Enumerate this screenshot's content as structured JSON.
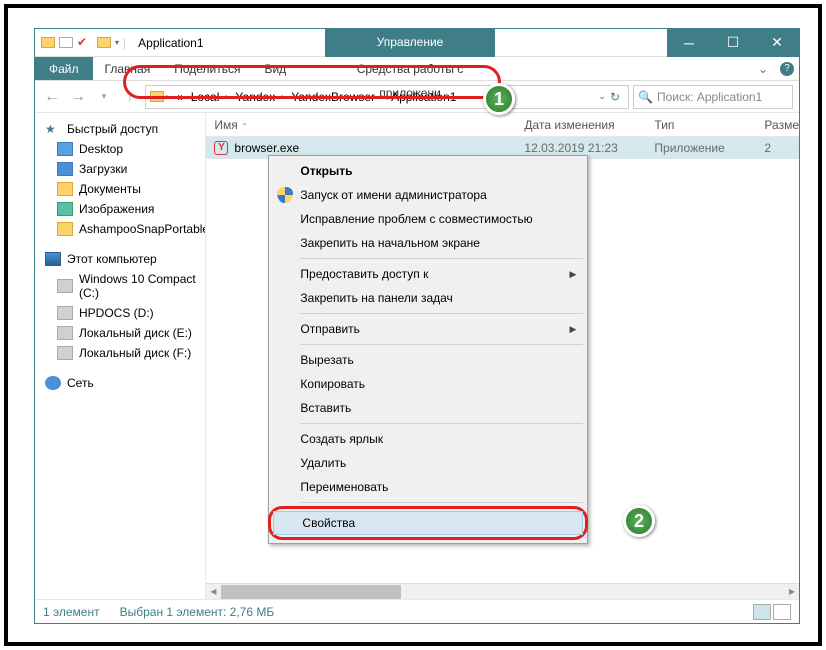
{
  "window": {
    "title": "Application1"
  },
  "ribbon": {
    "contextual_title": "Управление",
    "file": "Файл",
    "tabs": [
      "Главная",
      "Поделиться",
      "Вид"
    ],
    "contextual_tab": "Средства работы с приложени"
  },
  "breadcrumbs": {
    "prefix": "«",
    "items": [
      "Local",
      "Yandex",
      "YandexBrowser",
      "Application1"
    ]
  },
  "search": {
    "placeholder": "Поиск: Application1"
  },
  "sidebar": {
    "quick_access": "Быстрый доступ",
    "quick_items": [
      "Desktop",
      "Загрузки",
      "Документы",
      "Изображения",
      "AshampooSnapPortable"
    ],
    "this_pc": "Этот компьютер",
    "drives": [
      "Windows 10 Compact (C:)",
      "HPDOCS (D:)",
      "Локальный диск (E:)",
      "Локальный диск (F:)"
    ],
    "network": "Сеть"
  },
  "columns": {
    "name": "Имя",
    "date": "Дата изменения",
    "type": "Тип",
    "size": "Разме"
  },
  "file": {
    "name": "browser.exe",
    "date": "12.03.2019 21:23",
    "type": "Приложение",
    "size": "2"
  },
  "context_menu": {
    "open": "Открыть",
    "run_as_admin": "Запуск от имени администратора",
    "compat": "Исправление проблем с совместимостью",
    "pin_start": "Закрепить на начальном экране",
    "give_access": "Предоставить доступ к",
    "pin_taskbar": "Закрепить на панели задач",
    "send_to": "Отправить",
    "cut": "Вырезать",
    "copy": "Копировать",
    "paste": "Вставить",
    "shortcut": "Создать ярлык",
    "delete": "Удалить",
    "rename": "Переименовать",
    "properties": "Свойства"
  },
  "statusbar": {
    "count": "1 элемент",
    "selected": "Выбран 1 элемент: 2,76 МБ"
  },
  "markers": {
    "one": "1",
    "two": "2"
  }
}
